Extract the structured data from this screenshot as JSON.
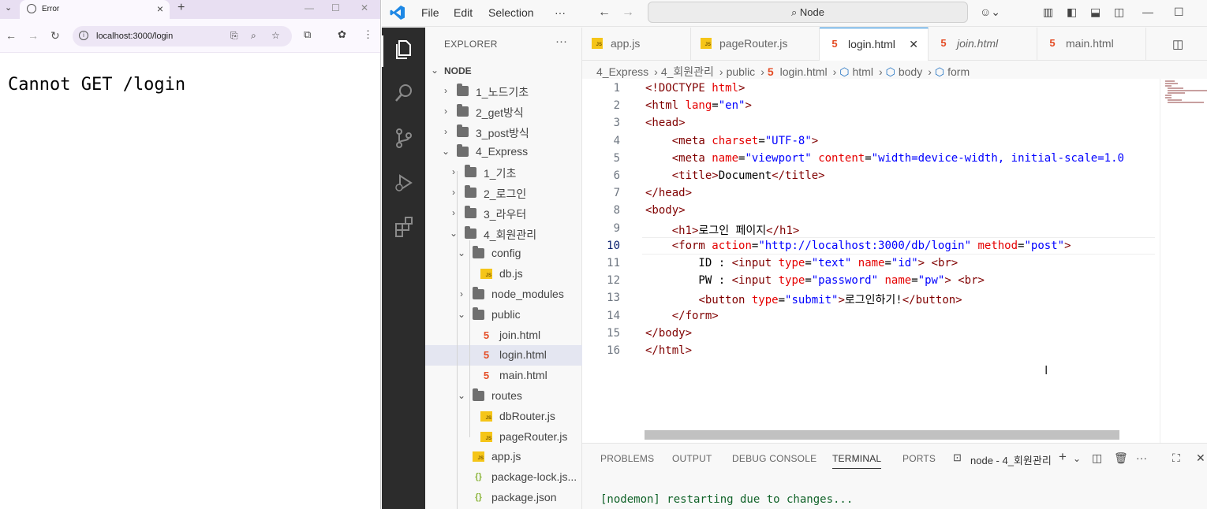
{
  "browser": {
    "tab_title": "Error",
    "url": "localhost:3000/login",
    "page_text": "Cannot GET /login"
  },
  "vscode": {
    "menu": [
      "File",
      "Edit",
      "Selection"
    ],
    "command_center": "Node",
    "explorer": {
      "title": "EXPLORER",
      "root": "NODE",
      "items": [
        {
          "label": "1_노드기초",
          "type": "folder",
          "depth": 1,
          "expanded": false
        },
        {
          "label": "2_get방식",
          "type": "folder",
          "depth": 1,
          "expanded": false
        },
        {
          "label": "3_post방식",
          "type": "folder",
          "depth": 1,
          "expanded": false
        },
        {
          "label": "4_Express",
          "type": "folder",
          "depth": 1,
          "expanded": true
        },
        {
          "label": "1_기초",
          "type": "folder",
          "depth": 2,
          "expanded": false
        },
        {
          "label": "2_로그인",
          "type": "folder",
          "depth": 2,
          "expanded": false
        },
        {
          "label": "3_라우터",
          "type": "folder",
          "depth": 2,
          "expanded": false
        },
        {
          "label": "4_회원관리",
          "type": "folder",
          "depth": 2,
          "expanded": true
        },
        {
          "label": "config",
          "type": "folder",
          "depth": 3,
          "expanded": true
        },
        {
          "label": "db.js",
          "type": "js",
          "depth": 4
        },
        {
          "label": "node_modules",
          "type": "folder",
          "depth": 3,
          "expanded": false
        },
        {
          "label": "public",
          "type": "folder",
          "depth": 3,
          "expanded": true
        },
        {
          "label": "join.html",
          "type": "html",
          "depth": 4
        },
        {
          "label": "login.html",
          "type": "html",
          "depth": 4,
          "selected": true
        },
        {
          "label": "main.html",
          "type": "html",
          "depth": 4
        },
        {
          "label": "routes",
          "type": "folder",
          "depth": 3,
          "expanded": true
        },
        {
          "label": "dbRouter.js",
          "type": "js",
          "depth": 4
        },
        {
          "label": "pageRouter.js",
          "type": "js",
          "depth": 4
        },
        {
          "label": "app.js",
          "type": "js",
          "depth": 3
        },
        {
          "label": "package-lock.js...",
          "type": "json",
          "depth": 3
        },
        {
          "label": "package.json",
          "type": "json",
          "depth": 3
        }
      ]
    },
    "tabs": [
      {
        "label": "app.js",
        "type": "js"
      },
      {
        "label": "pageRouter.js",
        "type": "js"
      },
      {
        "label": "login.html",
        "type": "html",
        "active": true
      },
      {
        "label": "join.html",
        "type": "html",
        "italic": true
      },
      {
        "label": "main.html",
        "type": "html"
      }
    ],
    "breadcrumb": [
      "4_Express",
      "4_회원관리",
      "public",
      "login.html",
      "html",
      "body",
      "form"
    ],
    "current_line": 10,
    "code_lines": [
      [
        [
          "tg",
          "<!DOCTYPE "
        ],
        [
          "at",
          "html"
        ],
        [
          "tg",
          ">"
        ]
      ],
      [
        [
          "tg",
          "<html "
        ],
        [
          "at",
          "lang"
        ],
        [
          "tx",
          "="
        ],
        [
          "st",
          "\"en\""
        ],
        [
          "tg",
          ">"
        ]
      ],
      [
        [
          "tg",
          "<head>"
        ]
      ],
      [
        [
          "tx",
          "    "
        ],
        [
          "tg",
          "<meta "
        ],
        [
          "at",
          "charset"
        ],
        [
          "tx",
          "="
        ],
        [
          "st",
          "\"UTF-8\""
        ],
        [
          "tg",
          ">"
        ]
      ],
      [
        [
          "tx",
          "    "
        ],
        [
          "tg",
          "<meta "
        ],
        [
          "at",
          "name"
        ],
        [
          "tx",
          "="
        ],
        [
          "st",
          "\"viewport\""
        ],
        [
          "tx",
          " "
        ],
        [
          "at",
          "content"
        ],
        [
          "tx",
          "="
        ],
        [
          "st",
          "\"width=device-width, initial-scale=1.0"
        ]
      ],
      [
        [
          "tx",
          "    "
        ],
        [
          "tg",
          "<title>"
        ],
        [
          "tx",
          "Document"
        ],
        [
          "tg",
          "</title>"
        ]
      ],
      [
        [
          "tg",
          "</head>"
        ]
      ],
      [
        [
          "tg",
          "<body>"
        ]
      ],
      [
        [
          "tx",
          "    "
        ],
        [
          "tg",
          "<h1>"
        ],
        [
          "tx",
          "로그인 페이지"
        ],
        [
          "tg",
          "</h1>"
        ]
      ],
      [
        [
          "tx",
          "    "
        ],
        [
          "tg",
          "<form "
        ],
        [
          "at",
          "action"
        ],
        [
          "tx",
          "="
        ],
        [
          "st",
          "\"http://localhost:3000/db/login\""
        ],
        [
          "tx",
          " "
        ],
        [
          "at",
          "method"
        ],
        [
          "tx",
          "="
        ],
        [
          "st",
          "\"post\""
        ],
        [
          "tg",
          ">"
        ]
      ],
      [
        [
          "tx",
          "        ID : "
        ],
        [
          "tg",
          "<input "
        ],
        [
          "at",
          "type"
        ],
        [
          "tx",
          "="
        ],
        [
          "st",
          "\"text\""
        ],
        [
          "tx",
          " "
        ],
        [
          "at",
          "name"
        ],
        [
          "tx",
          "="
        ],
        [
          "st",
          "\"id\""
        ],
        [
          "tg",
          ">"
        ],
        [
          "tx",
          " "
        ],
        [
          "tg",
          "<br>"
        ]
      ],
      [
        [
          "tx",
          "        PW : "
        ],
        [
          "tg",
          "<input "
        ],
        [
          "at",
          "type"
        ],
        [
          "tx",
          "="
        ],
        [
          "st",
          "\"password\""
        ],
        [
          "tx",
          " "
        ],
        [
          "at",
          "name"
        ],
        [
          "tx",
          "="
        ],
        [
          "st",
          "\"pw\""
        ],
        [
          "tg",
          ">"
        ],
        [
          "tx",
          " "
        ],
        [
          "tg",
          "<br>"
        ]
      ],
      [
        [
          "tx",
          "        "
        ],
        [
          "tg",
          "<button "
        ],
        [
          "at",
          "type"
        ],
        [
          "tx",
          "="
        ],
        [
          "st",
          "\"submit\""
        ],
        [
          "tg",
          ">"
        ],
        [
          "tx",
          "로그인하기!"
        ],
        [
          "tg",
          "</button>"
        ]
      ],
      [
        [
          "tx",
          "    "
        ],
        [
          "tg",
          "</form>"
        ]
      ],
      [
        [
          "tg",
          "</body>"
        ]
      ],
      [
        [
          "tg",
          "</html>"
        ]
      ]
    ],
    "panel_tabs": [
      "PROBLEMS",
      "OUTPUT",
      "DEBUG CONSOLE",
      "TERMINAL",
      "PORTS"
    ],
    "active_panel_tab": "TERMINAL",
    "terminal_name": "node - 4_회원관리",
    "terminal_output": "[nodemon] restarting due to changes..."
  },
  "colors": {
    "tag": "#800000",
    "attribute": "#e50000",
    "string": "#0000ff",
    "accent": "#0078d4",
    "terminal_green": "#116329"
  }
}
